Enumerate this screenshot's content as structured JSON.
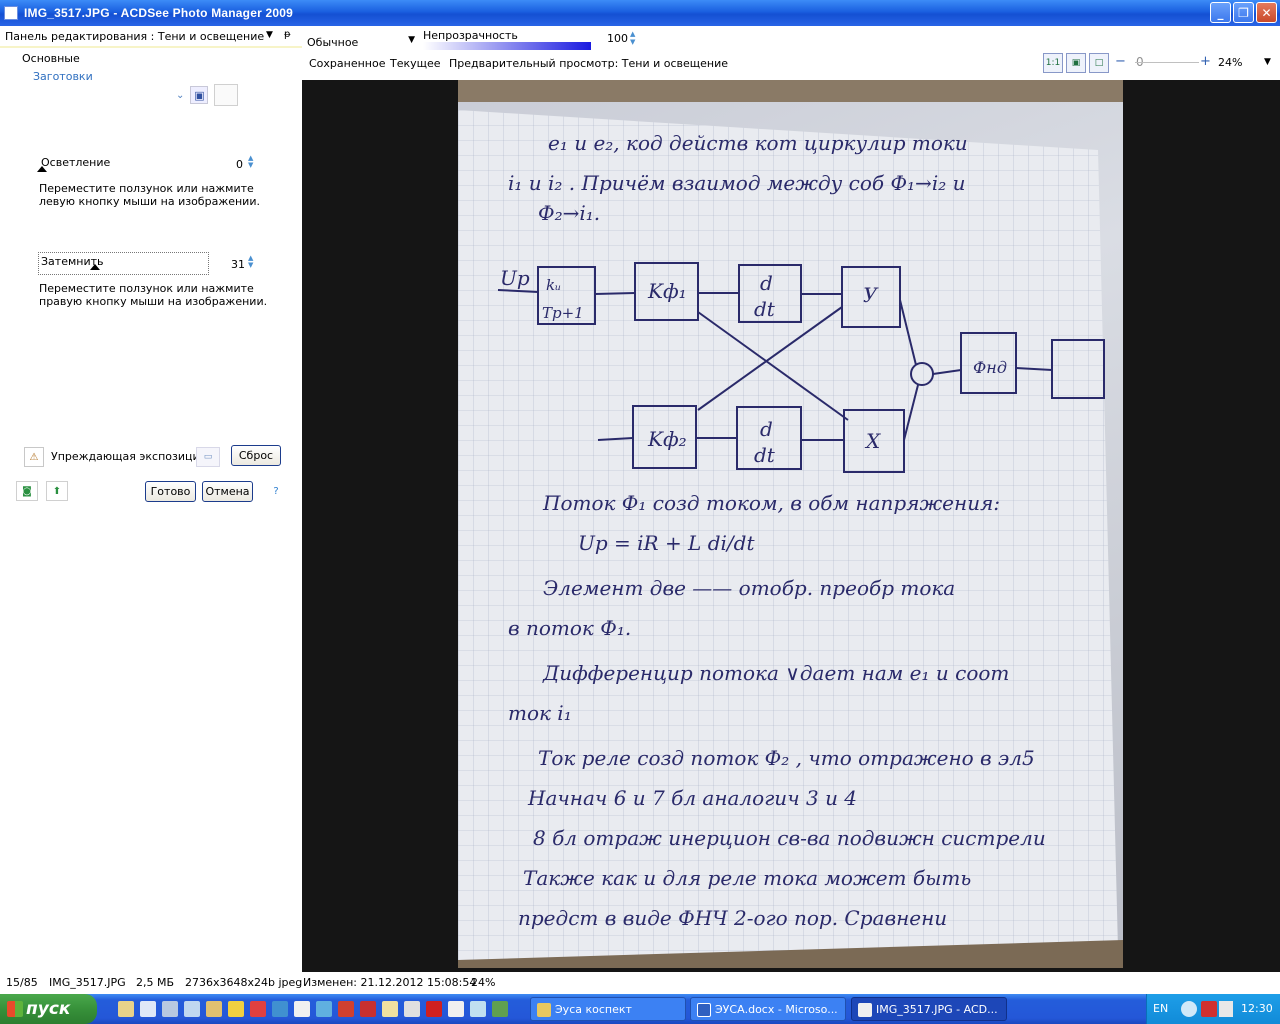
{
  "window": {
    "title": "IMG_3517.JPG - ACDSee Photo Manager 2009"
  },
  "left_panel": {
    "header": "Панель редактирования : Тени и освещение",
    "section_basic": "Основные",
    "presets_label": "Заготовки",
    "lighten": {
      "label": "Осветление",
      "value": "0",
      "level": 0.0,
      "hint": "Переместите ползунок или нажмите левую кнопку мыши на изображении."
    },
    "darken": {
      "label": "Затемнить",
      "value": "31",
      "level": 0.31,
      "hint": "Переместите ползунок или нажмите правую кнопку мыши на изображении."
    },
    "exposure_label": "Упреждающая экспозиция",
    "reset_button": "Сброс",
    "done_button": "Готово",
    "cancel_button": "Отмена"
  },
  "toolbar": {
    "blend_mode": "Обычное",
    "opacity_label": "Непрозрачность",
    "opacity_value": "100",
    "view_saved": "Сохраненное",
    "view_current": "Текущее",
    "view_preview": "Предварительный просмотр: Тени и освещение",
    "zoom_value": "24%",
    "zoom_offset": "0"
  },
  "status_bar": {
    "position": "15/85",
    "filename": "IMG_3517.JPG",
    "size": "2,5 МБ",
    "dimensions": "2736x3648x24b jpeg",
    "modified": "Изменен: 21.12.2012 15:08:54",
    "zoom": "24%"
  },
  "taskbar": {
    "start_label": "пуск",
    "tasks": [
      {
        "label": "Эуса коспект"
      },
      {
        "label": "ЭУСА.docx - Microso..."
      },
      {
        "label": "IMG_3517.JPG - ACD..."
      }
    ],
    "language": "EN",
    "clock": "12:30"
  },
  "colors": {
    "title_blue": "#1a5fe0",
    "taskbar_blue": "#245ddb",
    "start_green": "#37913a",
    "viewer_bg": "#151515"
  }
}
